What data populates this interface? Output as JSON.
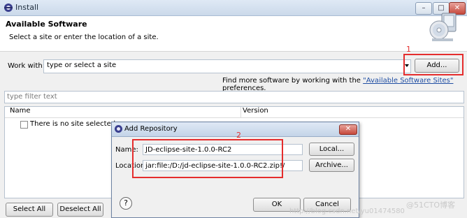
{
  "window": {
    "title": "Install",
    "controls": [
      "minimize",
      "maximize",
      "close"
    ]
  },
  "header": {
    "title": "Available Software",
    "subtitle": "Select a site or enter the location of a site."
  },
  "work_with": {
    "label": "Work with:",
    "value": "type or select a site",
    "add_button": "Add...",
    "annotation_number": "1",
    "find_more_prefix": "Find more software by working with the ",
    "find_more_link": "\"Available Software Sites\"",
    "find_more_suffix": " preferences."
  },
  "filter": {
    "placeholder": "type filter text"
  },
  "table": {
    "columns": [
      "Name",
      "Version"
    ],
    "empty_message": "There is no site selected."
  },
  "footer": {
    "select_all": "Select All",
    "deselect_all": "Deselect All"
  },
  "dialog": {
    "title": "Add Repository",
    "name_label": "Name:",
    "name_value": "JD-eclipse-site-1.0.0-RC2",
    "local_button": "Local...",
    "location_label": "Location:",
    "location_value": "jar:file:/D:/jd-eclipse-site-1.0.0-RC2.zip!/",
    "archive_button": "Archive...",
    "annotation_number": "2",
    "ok_button": "OK",
    "cancel_button": "Cancel",
    "help_icon": "?"
  },
  "watermark": {
    "url": "http://blog.csdn.net/yu01474580",
    "brand": "@51CTO博客"
  },
  "colors": {
    "annotation_red": "#e52d2d",
    "link_blue": "#1f4ea3",
    "title_gradient": "#cbd9ea"
  }
}
